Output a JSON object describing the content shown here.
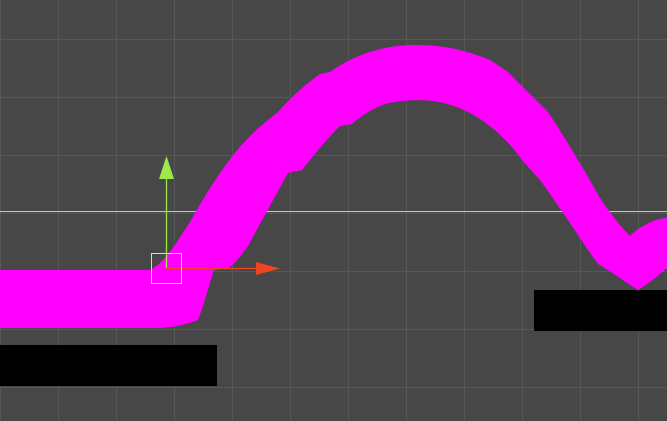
{
  "scene": {
    "background_color": "#474747",
    "grid_color": "#575757",
    "horizon_line_color": "#c9c9b6",
    "path_stroke_color": "#ff00ff",
    "platform_color": "#000000"
  },
  "gizmo": {
    "y_axis_color": "#9ee84a",
    "x_axis_color": "#ee4422",
    "handle_color": "#d9d9d9",
    "icons": [
      "move-tool-y-arrow-icon",
      "move-tool-x-arrow-icon",
      "move-tool-center-handle-icon"
    ]
  }
}
